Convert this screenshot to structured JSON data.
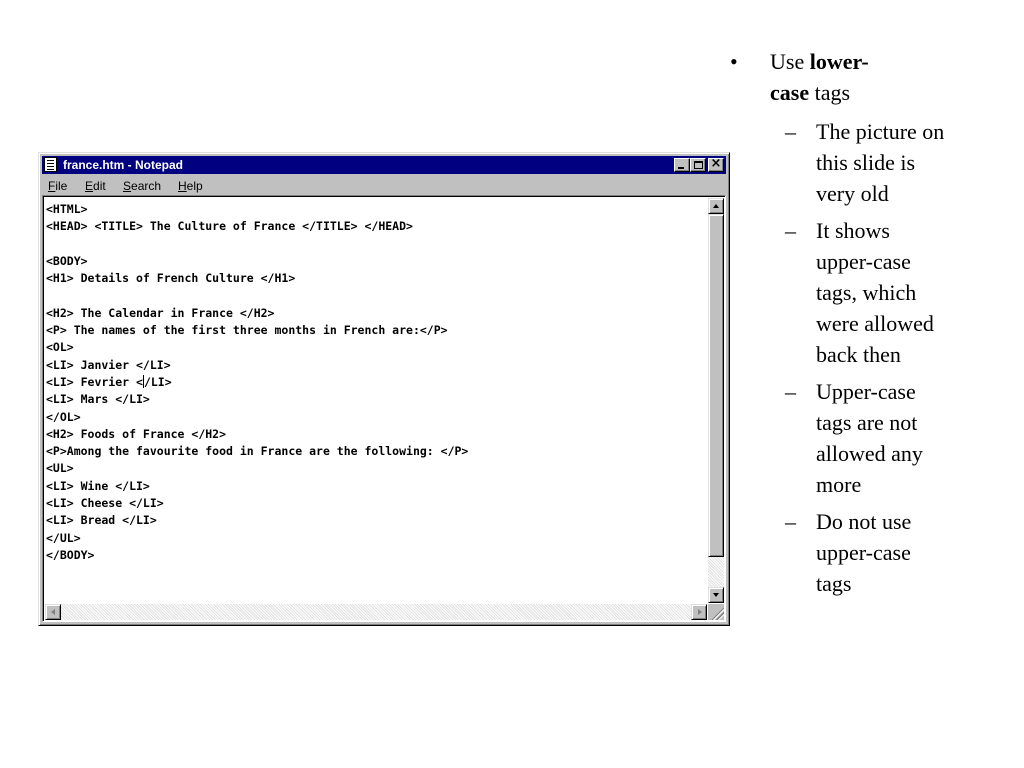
{
  "window": {
    "title": "france.htm - Notepad",
    "close_glyph": "×"
  },
  "menu": [
    {
      "accel": "F",
      "rest": "ile"
    },
    {
      "accel": "E",
      "rest": "dit"
    },
    {
      "accel": "S",
      "rest": "earch"
    },
    {
      "accel": "H",
      "rest": "elp"
    }
  ],
  "document": {
    "lines": [
      "<HTML>",
      "<HEAD> <TITLE> The Culture of France </TITLE> </HEAD>",
      "",
      "<BODY>",
      "<H1> Details of French Culture </H1>",
      "",
      "<H2> The Calendar in France </H2>",
      "<P> The names of the first three months in French are:</P>",
      "<OL>",
      "<LI> Janvier </LI>",
      "<LI> Fevrier </LI>",
      "<LI> Mars </LI>",
      "</OL>",
      "<H2> Foods of France </H2>",
      "<P>Among the favourite food in France are the following: </P>",
      "<UL>",
      "<LI> Wine </LI>",
      "<LI> Cheese </LI>",
      "<LI> Bread </LI>",
      "</UL>",
      "</BODY>"
    ],
    "caret_line": 10,
    "caret_col": 14
  },
  "slide": {
    "bullet_mark": "•",
    "bullet_pre": "Use ",
    "bullet_bold": "lower-case",
    "bullet_post": " tags",
    "sub_mark": "–",
    "sub_items": [
      "The picture on this slide is very old",
      "It shows upper-case tags, which were allowed back then",
      "Upper-case tags are not allowed any more",
      "Do not use upper-case tags"
    ]
  }
}
